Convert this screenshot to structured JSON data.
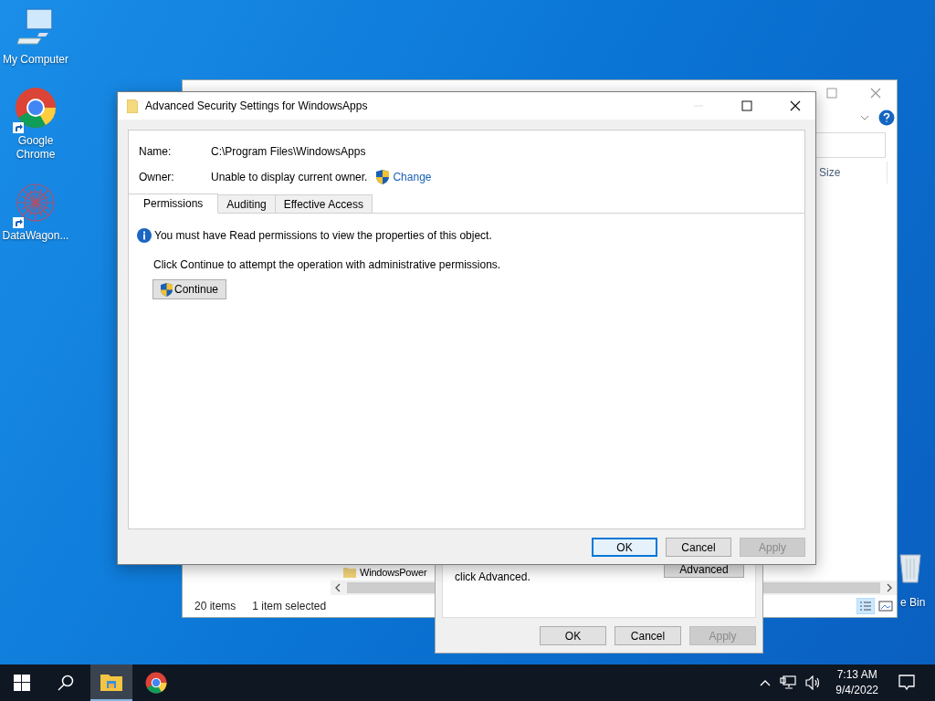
{
  "desktop_icons": [
    {
      "kind": "computer",
      "label": "My Computer",
      "shortcut": false
    },
    {
      "kind": "chrome",
      "label": "Google Chrome",
      "shortcut": true
    },
    {
      "kind": "mesh",
      "label": "DataWagon...",
      "shortcut": true
    }
  ],
  "recycle_bin": {
    "label": "e Bin"
  },
  "explorer": {
    "column_header": "Size",
    "items": [
      {
        "name": "WindowsPower"
      }
    ],
    "status": [
      "20 items",
      "1 item selected"
    ]
  },
  "properties_dialog": {
    "note": "click Advanced.",
    "advanced_button": "Advanced",
    "buttons": [
      {
        "label": "OK",
        "default": false,
        "disabled": false
      },
      {
        "label": "Cancel",
        "default": false,
        "disabled": false
      },
      {
        "label": "Apply",
        "default": false,
        "disabled": true
      }
    ]
  },
  "dialog": {
    "title": "Advanced Security Settings for WindowsApps",
    "name_label": "Name:",
    "name_value": "C:\\Program Files\\WindowsApps",
    "owner_label": "Owner:",
    "owner_value": "Unable to display current owner.",
    "change_link": "Change",
    "tabs": [
      {
        "label": "Permissions",
        "selected": true
      },
      {
        "label": "Auditing",
        "selected": false
      },
      {
        "label": "Effective Access",
        "selected": false
      }
    ],
    "info": "You must have Read permissions to view the properties of this object.",
    "instruction": "Click Continue to attempt the operation with administrative permissions.",
    "continue_button": "Continue",
    "buttons": [
      {
        "label": "OK",
        "default": true,
        "disabled": false
      },
      {
        "label": "Cancel",
        "default": false,
        "disabled": false
      },
      {
        "label": "Apply",
        "default": false,
        "disabled": true
      }
    ]
  },
  "taskbar": {
    "apps": [
      {
        "kind": "explorer",
        "active": true
      },
      {
        "kind": "chrome",
        "active": false
      }
    ],
    "time": "7:13 AM",
    "date": "9/4/2022"
  }
}
